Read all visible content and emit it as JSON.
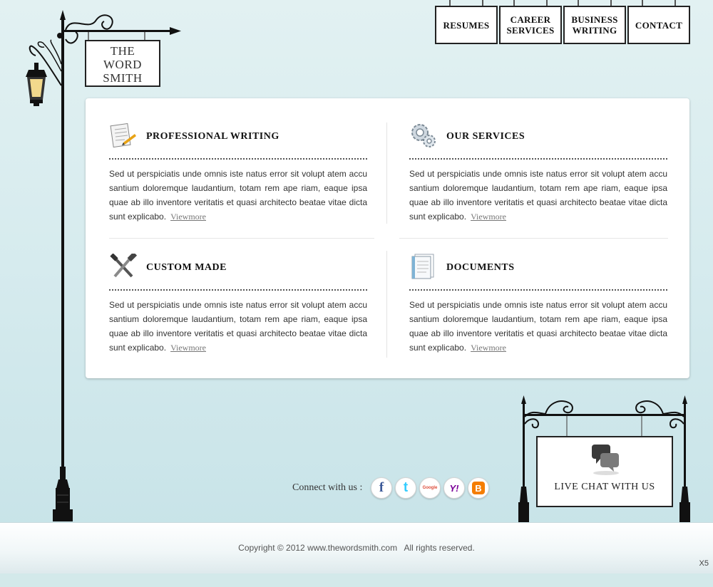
{
  "logo": {
    "lines": [
      "THE",
      "WORD",
      "SMITH"
    ]
  },
  "nav": {
    "items": [
      {
        "label": "RESUMES"
      },
      {
        "label": "CAREER SERVICES"
      },
      {
        "label": "BUSINESS WRITING"
      },
      {
        "label": "CONTACT"
      }
    ]
  },
  "panels": [
    {
      "title": "PROFESSIONAL WRITING",
      "icon": "notepad-pencil-icon",
      "text": "Sed ut perspiciatis unde omnis iste natus error sit volupt atem accu santium doloremque laudantium, totam rem ape riam, eaque ipsa quae ab illo inventore veritatis et quasi architecto beatae vitae dicta sunt explicabo.",
      "link": "Viewmore"
    },
    {
      "title": "OUR SERVICES",
      "icon": "gears-icon",
      "text": "Sed ut perspiciatis unde omnis iste natus error sit volupt atem accu santium doloremque laudantium, totam rem ape riam, eaque ipsa quae ab illo inventore veritatis et quasi architecto beatae vitae dicta sunt explicabo.",
      "link": "Viewmore"
    },
    {
      "title": "CUSTOM MADE",
      "icon": "tools-icon",
      "text": "Sed ut perspiciatis unde omnis iste natus error sit volupt atem accu santium doloremque laudantium, totam rem ape riam, eaque ipsa quae ab illo inventore veritatis et quasi architecto beatae vitae dicta sunt explicabo.",
      "link": "Viewmore"
    },
    {
      "title": "DOCUMENTS",
      "icon": "documents-icon",
      "text": "Sed ut perspiciatis unde omnis iste natus error sit volupt atem accu santium doloremque laudantium, totam rem ape riam, eaque ipsa quae ab illo inventore veritatis et quasi architecto beatae vitae dicta sunt explicabo.",
      "link": "Viewmore"
    }
  ],
  "connect": {
    "label": "Connect with us :",
    "social": [
      {
        "icon": "facebook-icon",
        "glyph": "f",
        "color": "#3b5998"
      },
      {
        "icon": "twitter-icon",
        "glyph": "t",
        "color": "#33ccff"
      },
      {
        "icon": "google-icon",
        "glyph": "Google",
        "color": "#dd4b39"
      },
      {
        "icon": "yahoo-icon",
        "glyph": "Y!",
        "color": "#7b0099"
      },
      {
        "icon": "blogger-icon",
        "glyph": "B",
        "color": "#f57d00"
      }
    ]
  },
  "chat": {
    "label": "LIVE CHAT WITH US",
    "icon": "chat-bubbles-icon"
  },
  "footer": {
    "copyright": "Copyright © 2012 www.thewordsmith.com   All rights reserved.",
    "badge": "X5"
  },
  "colors": {
    "background": "#d6ebee",
    "ink": "#111111",
    "link": "#777777"
  }
}
